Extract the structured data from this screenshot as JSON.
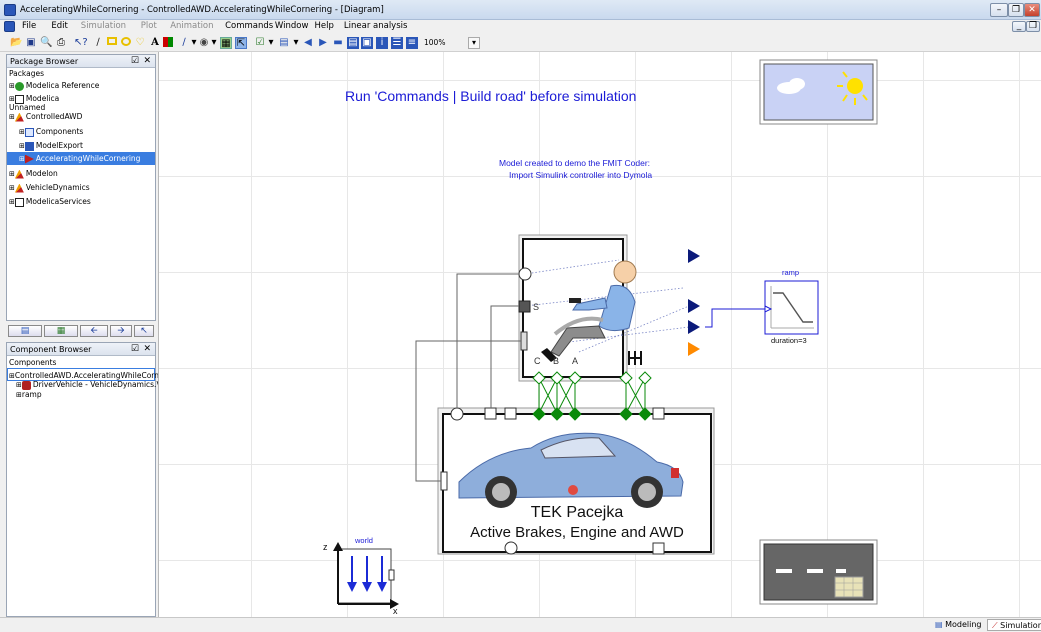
{
  "window": {
    "title": "AcceleratingWhileCornering - ControlledAWD.AcceleratingWhileCornering - [Diagram]"
  },
  "menu": [
    "File",
    "Edit",
    "Simulation",
    "Plot",
    "Animation",
    "Commands",
    "Window",
    "Help",
    "Linear analysis"
  ],
  "menu_disabled": [
    "Simulation",
    "Plot",
    "Animation"
  ],
  "toolbar": {
    "zoom": "100%"
  },
  "package_browser": {
    "title": "Package Browser",
    "header": "Packages",
    "items": [
      {
        "label": "Modelica Reference",
        "indent": 0,
        "icon": "info-icon"
      },
      {
        "label": "Modelica",
        "indent": 0,
        "icon": "package-icon"
      },
      {
        "label": "Unnamed",
        "indent": 0,
        "icon": ""
      },
      {
        "label": "ControlledAWD",
        "indent": 0,
        "icon": "vehicle-lib-icon"
      },
      {
        "label": "Components",
        "indent": 1,
        "icon": "component-icon"
      },
      {
        "label": "ModelExport",
        "indent": 1,
        "icon": "export-icon"
      },
      {
        "label": "AcceleratingWhileCornering",
        "indent": 1,
        "icon": "model-icon",
        "selected": true
      },
      {
        "label": "Modelon",
        "indent": 0,
        "icon": "vehicle-lib-icon"
      },
      {
        "label": "VehicleDynamics",
        "indent": 0,
        "icon": "vehicle-lib-icon"
      },
      {
        "label": "ModelicaServices",
        "indent": 0,
        "icon": "package-icon"
      }
    ]
  },
  "component_browser": {
    "title": "Component Browser",
    "header": "Components",
    "items": [
      {
        "label": "ControlledAWD.AcceleratingWhileCornering",
        "indent": 0,
        "selected": true
      },
      {
        "label": "DriverVehicle - VehicleDynamics.Vehicl...",
        "indent": 1
      },
      {
        "label": "ramp",
        "indent": 1
      }
    ]
  },
  "diagram": {
    "note_main": "Run 'Commands | Build road' before simulation",
    "note_sub_1": "Model created to demo the FMIT Coder:",
    "note_sub_2": "Import Simulink controller into Dymola",
    "ramp_label": "ramp",
    "ramp_param": "duration=3",
    "world_label": "world",
    "axis_z": "z",
    "axis_x": "x",
    "driver_port_s": "S",
    "driver_port_c": "C",
    "driver_port_b": "B",
    "driver_port_a": "A",
    "vehicle_name": "TEK Pacejka",
    "vehicle_desc": "Active Brakes, Engine and AWD"
  },
  "status": {
    "modes": [
      {
        "label": "Modeling",
        "active": false
      },
      {
        "label": "Simulation",
        "active": true
      }
    ]
  },
  "colors": {
    "note_blue": "#1b1bd6",
    "connector_green": "#0a8a0a",
    "port_navy": "#0b1a7a",
    "port_orange": "#ff8a00",
    "sky": "#c9d2f5"
  }
}
